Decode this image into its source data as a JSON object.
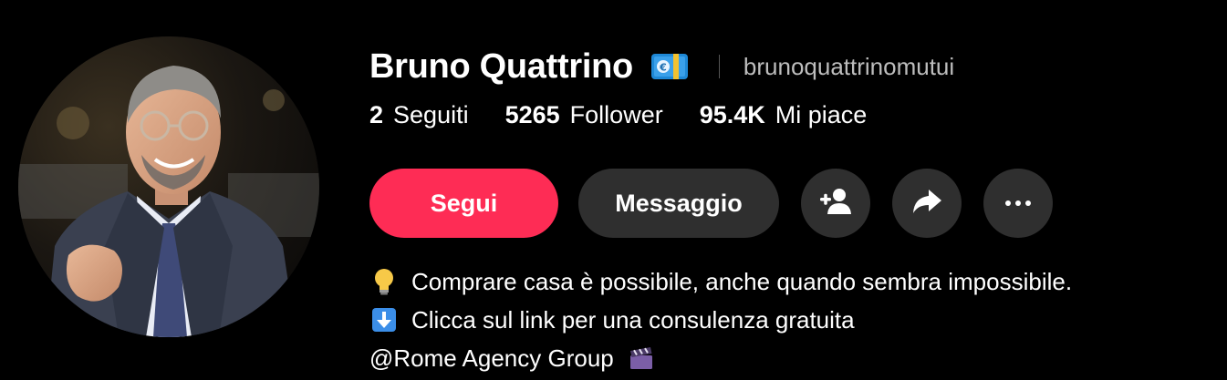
{
  "profile": {
    "display_name": "Bruno Quattrino",
    "username": "brunoquattrinomutui",
    "badge_icon": "euro-banknote-icon",
    "avatar_icon": "profile-photo"
  },
  "stats": {
    "following_value": "2",
    "following_label": "Seguiti",
    "followers_value": "5265",
    "followers_label": "Follower",
    "likes_value": "95.4K",
    "likes_label": "Mi piace"
  },
  "actions": {
    "follow_label": "Segui",
    "message_label": "Messaggio",
    "add_friend_icon": "add-friend-icon",
    "share_icon": "share-icon",
    "more_icon": "more-icon"
  },
  "bio": {
    "line1": "Comprare casa è possibile, anche quando sembra impossibile.",
    "line1_icon": "light-bulb-icon",
    "line2": "Clicca sul link per una consulenza gratuita",
    "line2_icon": "down-arrow-icon",
    "line3": "@Rome Agency Group",
    "line3_icon": "clapper-board-icon"
  },
  "colors": {
    "background": "#000000",
    "follow_button": "#fe2c55",
    "secondary_button": "#2f2f2f",
    "username": "#bdbdbd"
  }
}
